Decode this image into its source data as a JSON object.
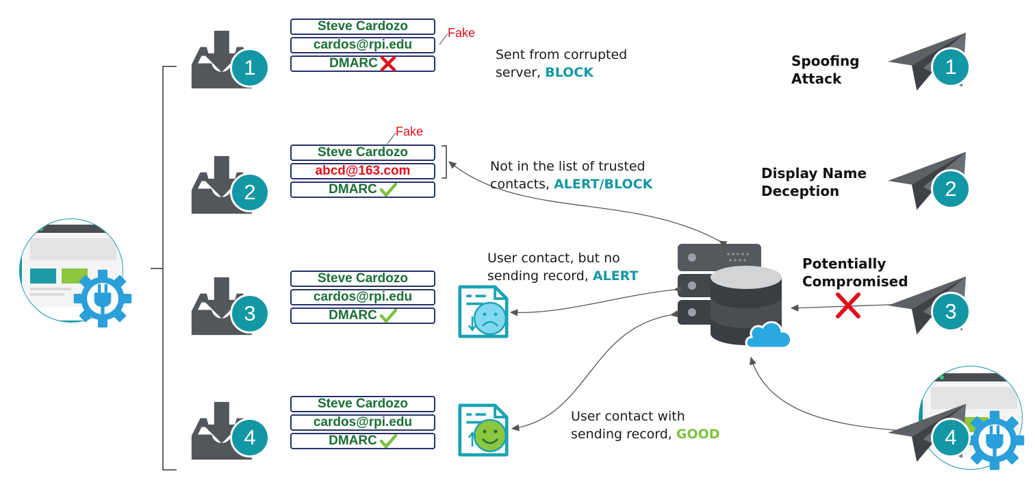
{
  "fake_label": "Fake",
  "rows": [
    {
      "number": "1",
      "name": "Steve Cardozo",
      "email": "cardos@rpi.edu",
      "dmarc": "DMARC",
      "dmarc_status": "fail",
      "desc_lines": [
        "Sent from corrupted",
        "server, "
      ],
      "action": "BLOCK",
      "attack_lines": [
        "Spoofing",
        "Attack"
      ]
    },
    {
      "number": "2",
      "name": "Steve Cardozo",
      "email": "abcd@163.com",
      "dmarc": "DMARC",
      "dmarc_status": "pass",
      "desc_lines": [
        "Not in the list of trusted",
        "contacts, "
      ],
      "action": "ALERT/BLOCK",
      "attack_lines": [
        "Display Name",
        "Deception"
      ]
    },
    {
      "number": "3",
      "name": "Steve Cardozo",
      "email": "cardos@rpi.edu",
      "dmarc": "DMARC",
      "dmarc_status": "pass",
      "desc_lines": [
        "User contact, but no",
        "sending record, "
      ],
      "action": "ALERT",
      "attack_lines": [
        "Potentially",
        "Compromised"
      ]
    },
    {
      "number": "4",
      "name": "Steve Cardozo",
      "email": "cardos@rpi.edu",
      "dmarc": "DMARC",
      "dmarc_status": "pass",
      "desc_lines": [
        "User contact with",
        "sending record, "
      ],
      "action": "GOOD",
      "attack_lines": [
        "",
        ""
      ]
    }
  ],
  "colors": {
    "teal": "#1497a4",
    "dark_gray": "#53565b",
    "green_text": "#1a6e35",
    "red": "#e0101b",
    "navy_border": "#26306b",
    "good_green": "#7cc242",
    "gear_blue": "#2b9fd9"
  }
}
